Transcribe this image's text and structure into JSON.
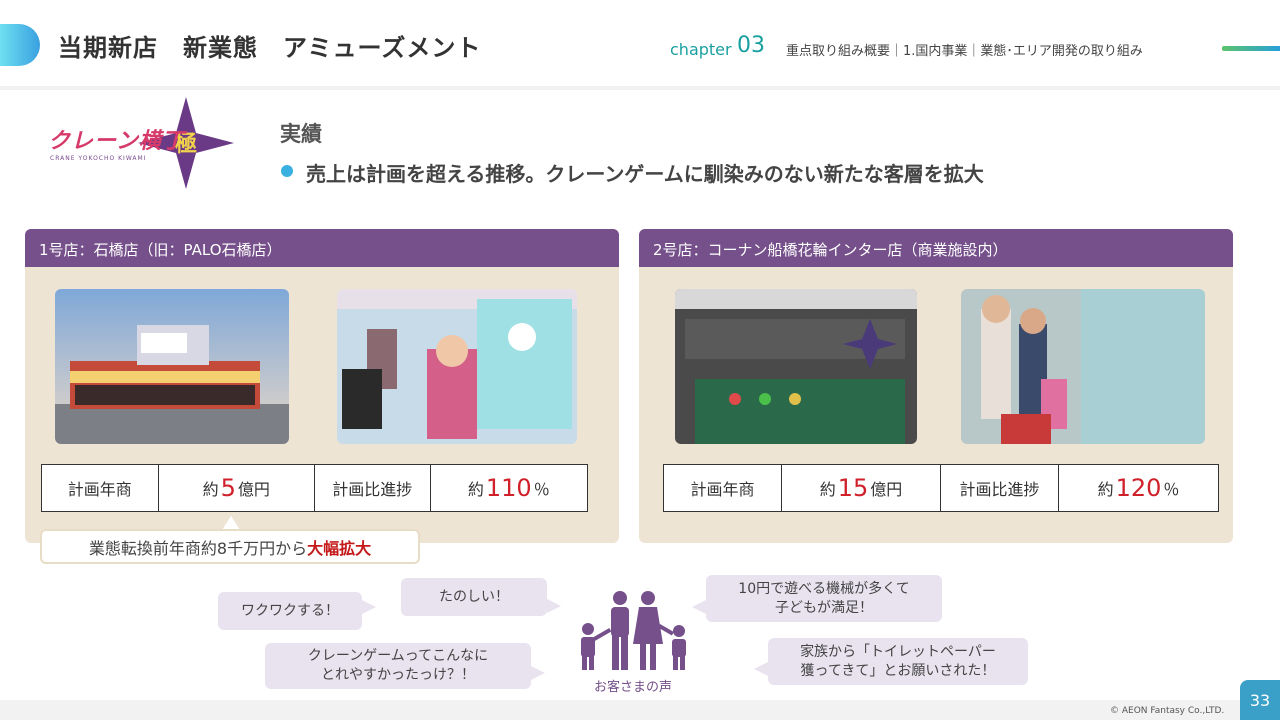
{
  "header": {
    "title": "当期新店　新業態　アミューズメント",
    "chapter_label": "chapter",
    "chapter_number": "03",
    "breadcrumb": "重点取り組み概要｜1.国内事業｜業態･エリア開発の取り組み"
  },
  "logo": {
    "text": "クレーン横丁",
    "emblem": "極",
    "subtitle": "CRANE YOKOCHO KIWAMI"
  },
  "results": {
    "heading": "実績",
    "bullet": "売上は計画を超える推移。クレーンゲームに馴染みのない新たな客層を拡大"
  },
  "stores": [
    {
      "title": "1号店：石橋店（旧：PALO石橋店）",
      "plan_label": "計画年商",
      "plan_prefix": "約",
      "plan_value": "5",
      "plan_unit": "億円",
      "progress_label": "計画比進捗",
      "progress_prefix": "約",
      "progress_value": "110",
      "progress_unit": "％"
    },
    {
      "title": "2号店：コーナン船橋花輪インター店（商業施設内）",
      "plan_label": "計画年商",
      "plan_prefix": "約",
      "plan_value": "15",
      "plan_unit": "億円",
      "progress_label": "計画比進捗",
      "progress_prefix": "約",
      "progress_value": "120",
      "progress_unit": "％"
    }
  ],
  "callout": {
    "text": "業態転換前年商約8千万円から",
    "emphasis": "大幅拡大"
  },
  "voices": {
    "label": "お客さまの声",
    "bubbles": [
      "ワクワクする！",
      "たのしい！",
      "クレーンゲームってこんなに",
      "とれやすかったっけ？！",
      "10円で遊べる機械が多くて",
      "子どもが満足！",
      "家族から「トイレットペーパー",
      "獲ってきて」とお願いされた！"
    ]
  },
  "footer": {
    "copyright": "© AEON Fantasy Co.,LTD.",
    "page": "33"
  },
  "colors": {
    "accent_purple": "#75508a",
    "accent_teal": "#1a9fa0",
    "highlight_red": "#d0202a",
    "card_bg": "#eee4d4"
  }
}
